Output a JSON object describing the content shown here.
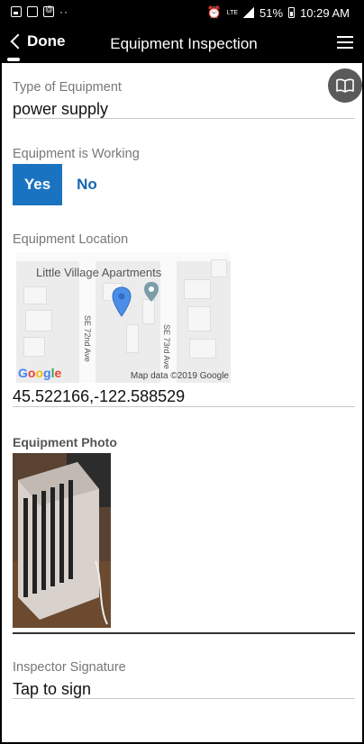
{
  "status_bar": {
    "network": "LTE",
    "battery": "51%",
    "time": "10:29 AM"
  },
  "header": {
    "back_label": "Done",
    "title": "Equipment Inspection"
  },
  "fields": {
    "type_of_equipment": {
      "label": "Type of Equipment",
      "value": "power supply"
    },
    "equipment_working": {
      "label": "Equipment is Working",
      "yes": "Yes",
      "no": "No",
      "selected": "Yes"
    },
    "equipment_location": {
      "label": "Equipment Location",
      "coordinates": "45.522166,-122.588529",
      "map": {
        "place": "Little Village Apartments",
        "street_1": "SE 72nd Ave",
        "street_2": "SE 73rd Ave",
        "logo": "Google",
        "credit": "Map data ©2019 Google"
      }
    },
    "equipment_photo": {
      "label": "Equipment Photo"
    },
    "inspector_signature": {
      "label": "Inspector Signature",
      "value": "Tap to sign"
    }
  },
  "colors": {
    "accent": "#1a73c0",
    "link": "#1565b0",
    "header_bg": "#000000",
    "book_button": "#5a5a5a"
  },
  "icons": {
    "back": "chevron-left-icon",
    "menu": "hamburger-menu-icon",
    "book": "open-book-icon",
    "map_pin": "map-pin-icon"
  }
}
